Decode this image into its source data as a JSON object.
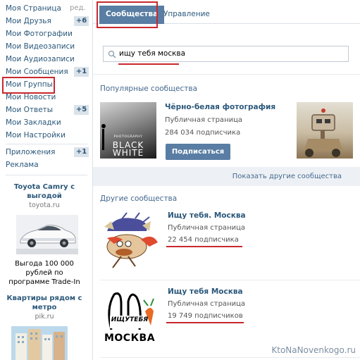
{
  "sidebar": {
    "edit_label": "ред.",
    "items": [
      {
        "label": "Моя Страница"
      },
      {
        "label": "Мои Друзья",
        "badge": "+6"
      },
      {
        "label": "Мои Фотографии"
      },
      {
        "label": "Мои Видеозаписи"
      },
      {
        "label": "Мои Аудиозаписи"
      },
      {
        "label": "Мои Сообщения",
        "badge": "+1"
      },
      {
        "label": "Мои Группы"
      },
      {
        "label": "Мои Новости"
      },
      {
        "label": "Мои Ответы",
        "badge": "+5"
      },
      {
        "label": "Мои Закладки"
      },
      {
        "label": "Мои Настройки"
      }
    ],
    "extra_items": [
      {
        "label": "Приложения",
        "badge": "+1"
      },
      {
        "label": "Реклама"
      }
    ],
    "ads": [
      {
        "title": "Toyota Camry с выгодой",
        "domain": "toyota.ru",
        "text": "Выгода 100 000 рублей по программе Trade-In"
      },
      {
        "title": "Квартиры рядом с метро",
        "domain": "pik.ru"
      }
    ]
  },
  "tabs": [
    {
      "label": "Сообщества"
    },
    {
      "label": "Управление"
    }
  ],
  "search": {
    "value": "ищу тебя москва"
  },
  "popular": {
    "title": "Популярные сообщества",
    "item": {
      "name": "Чёрно-белая фотография",
      "type": "Публичная страница",
      "subscribers": "284 034 подписчика",
      "image_caption_small": "PHOTOGRAPHY",
      "image_caption_big1": "BLACK",
      "image_caption_big2": "WHITE"
    },
    "subscribe_label": "Подписаться",
    "show_more": "Показать другие сообщества"
  },
  "others": {
    "title": "Другие сообщества",
    "groups": [
      {
        "name": "Ищу тебя. Москва",
        "type": "Публичная страница",
        "subscribers": "22 454 подписчика"
      },
      {
        "name": "Ищу тебя Москва",
        "type": "Публичная страница",
        "subscribers": "19 749 подписчиков",
        "logo_top": "ИЩУТЕБЯ",
        "logo_bottom": "МОСКВА"
      }
    ]
  },
  "watermark": "KtoNaNovenkogo.ru",
  "colors": {
    "accent": "#597da3",
    "link": "#2b587a",
    "highlight": "#c9282d"
  }
}
